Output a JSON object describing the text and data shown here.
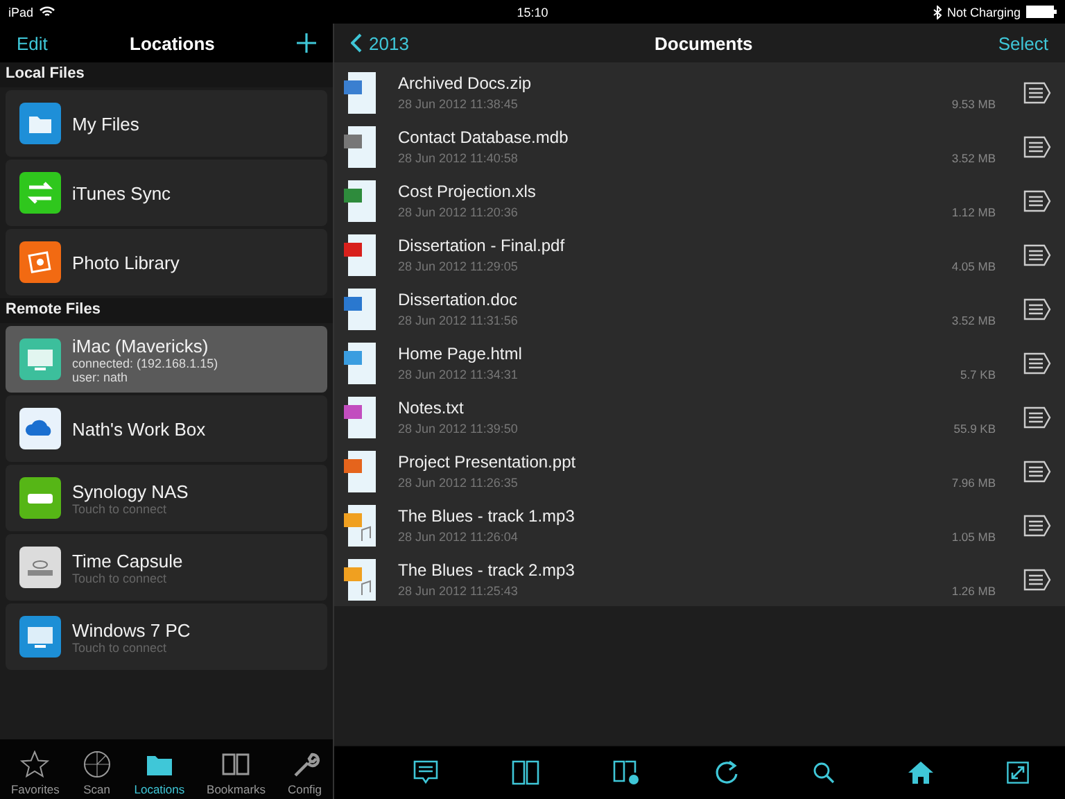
{
  "status_bar": {
    "device": "iPad",
    "time": "15:10",
    "battery": "Not Charging"
  },
  "left_nav": {
    "edit": "Edit",
    "title": "Locations"
  },
  "right_nav": {
    "back": "2013",
    "title": "Documents",
    "select": "Select"
  },
  "sections": [
    {
      "title": "Local Files",
      "items": [
        {
          "kind": "folder",
          "name": "My Files",
          "selected": false
        },
        {
          "kind": "sync",
          "name": "iTunes Sync",
          "selected": false
        },
        {
          "kind": "photos",
          "name": "Photo Library",
          "selected": false
        }
      ]
    },
    {
      "title": "Remote Files",
      "items": [
        {
          "kind": "monitor",
          "name": "iMac (Mavericks)",
          "details": [
            "connected: (192.168.1.15)",
            "user: nath"
          ],
          "selected": true
        },
        {
          "kind": "cloud",
          "name": "Nath's Work Box",
          "selected": false
        },
        {
          "kind": "nas",
          "name": "Synology NAS",
          "details": [
            "Touch to connect"
          ],
          "selected": false
        },
        {
          "kind": "capsule",
          "name": "Time Capsule",
          "details": [
            "Touch to connect"
          ],
          "selected": false
        },
        {
          "kind": "pc",
          "name": "Windows 7 PC",
          "details": [
            "Touch to connect"
          ],
          "selected": false
        }
      ]
    }
  ],
  "files": [
    {
      "kind": "zip",
      "name": "Archived Docs.zip",
      "date": "28 Jun 2012 11:38:45",
      "size": "9.53 MB"
    },
    {
      "kind": "mdb",
      "name": "Contact Database.mdb",
      "date": "28 Jun 2012 11:40:58",
      "size": "3.52 MB"
    },
    {
      "kind": "xls",
      "name": "Cost Projection.xls",
      "date": "28 Jun 2012 11:20:36",
      "size": "1.12 MB"
    },
    {
      "kind": "pdf",
      "name": "Dissertation - Final.pdf",
      "date": "28 Jun 2012 11:29:05",
      "size": "4.05 MB"
    },
    {
      "kind": "doc",
      "name": "Dissertation.doc",
      "date": "28 Jun 2012 11:31:56",
      "size": "3.52 MB"
    },
    {
      "kind": "html",
      "name": "Home Page.html",
      "date": "28 Jun 2012 11:34:31",
      "size": "5.7 KB"
    },
    {
      "kind": "txt",
      "name": "Notes.txt",
      "date": "28 Jun 2012 11:39:50",
      "size": "55.9 KB"
    },
    {
      "kind": "ppt",
      "name": "Project Presentation.ppt",
      "date": "28 Jun 2012 11:26:35",
      "size": "7.96 MB"
    },
    {
      "kind": "mp3",
      "name": "The Blues - track 1.mp3",
      "date": "28 Jun 2012 11:26:04",
      "size": "1.05 MB"
    },
    {
      "kind": "mp3",
      "name": "The Blues - track 2.mp3",
      "date": "28 Jun 2012 11:25:43",
      "size": "1.26 MB"
    }
  ],
  "tab_bar": [
    {
      "kind": "star",
      "label": "Favorites",
      "selected": false
    },
    {
      "kind": "radar",
      "label": "Scan",
      "selected": false
    },
    {
      "kind": "folder",
      "label": "Locations",
      "selected": true
    },
    {
      "kind": "book",
      "label": "Bookmarks",
      "selected": false
    },
    {
      "kind": "wrench",
      "label": "Config",
      "selected": false
    }
  ]
}
